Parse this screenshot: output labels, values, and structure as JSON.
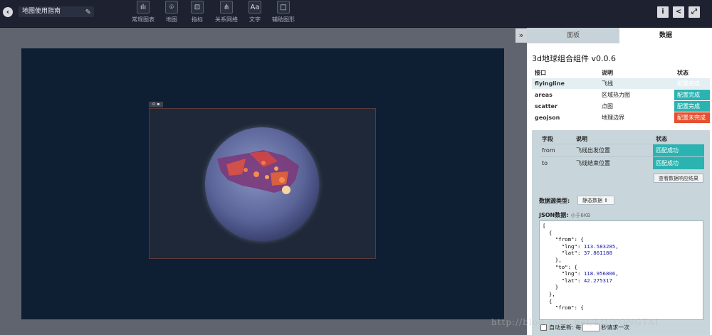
{
  "header": {
    "back_icon": "chevron-left-icon",
    "title": "地图使用指南",
    "tools": [
      {
        "label": "常规图表",
        "icon": "bar-chart-icon",
        "glyph": "ılı"
      },
      {
        "label": "地图",
        "icon": "map-pin-icon",
        "glyph": "⌾"
      },
      {
        "label": "指标",
        "icon": "indicator-icon",
        "glyph": "⊡"
      },
      {
        "label": "关系网络",
        "icon": "network-icon",
        "glyph": "⋔"
      },
      {
        "label": "文字",
        "icon": "text-icon",
        "glyph": "Aa"
      },
      {
        "label": "辅助图形",
        "icon": "shape-icon",
        "glyph": "□"
      }
    ],
    "right_buttons": [
      {
        "icon": "info-icon",
        "glyph": "i"
      },
      {
        "icon": "share-icon",
        "glyph": "<"
      },
      {
        "icon": "fullscreen-icon",
        "glyph": "⤢"
      }
    ]
  },
  "panel": {
    "collapse_glyph": "»",
    "tabs": [
      "面板",
      "数据"
    ],
    "component_title": "3d地球组合组件 v0.0.6",
    "interface_table": {
      "headers": [
        "接口",
        "说明",
        "状态"
      ],
      "rows": [
        {
          "key": "flyingline",
          "desc": "飞线",
          "status": "配置完成"
        },
        {
          "key": "areas",
          "desc": "区域热力图",
          "status": "配置完成"
        },
        {
          "key": "scatter",
          "desc": "点图",
          "status": "配置完成"
        },
        {
          "key": "geojson",
          "desc": "地理边界",
          "status": "配置未完成"
        }
      ]
    },
    "field_table": {
      "headers": [
        "字段",
        "说明",
        "状态"
      ],
      "rows": [
        {
          "field": "from",
          "desc": "飞线出发位置",
          "status": "匹配成功"
        },
        {
          "field": "to",
          "desc": "飞线结束位置",
          "status": "匹配成功"
        }
      ]
    },
    "view_result_button": "查看数据响应结果",
    "datasource_label": "数据源类型:",
    "datasource_value": "静态数据",
    "json_label": "JSON数据:",
    "json_size_hint": "小于6KB",
    "json_lines": [
      "[",
      "  {",
      "    \"from\": {",
      "      \"lng\": 113.583285,",
      "      \"lat\": 37.861188",
      "    },",
      "    \"to\": {",
      "      \"lng\": 118.956806,",
      "      \"lat\": 42.275317",
      "    }",
      "  },",
      "  {",
      "    \"from\": {"
    ],
    "auto_update": {
      "label": "自动更新: 每",
      "suffix": "秒请求一次"
    }
  },
  "watermark": "http://blog.csdn.net/LIUYONGTAI"
}
